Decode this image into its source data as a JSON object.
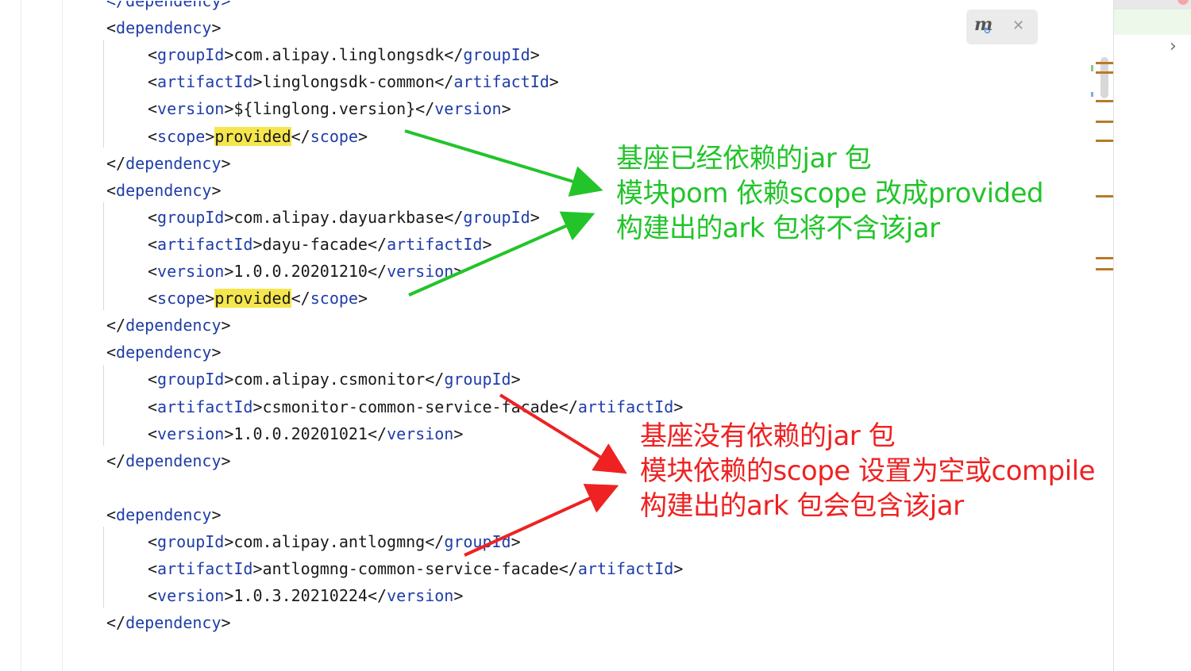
{
  "editor": {
    "lines": [
      {
        "kind": "text",
        "text": "</dependency>"
      },
      {
        "kind": "open",
        "tag": "dependency"
      },
      {
        "kind": "elem",
        "tag": "groupId",
        "value": "com.alipay.linglongsdk"
      },
      {
        "kind": "elem",
        "tag": "artifactId",
        "value": "linglongsdk-common"
      },
      {
        "kind": "elem",
        "tag": "version",
        "value": "${linglong.version}"
      },
      {
        "kind": "elem",
        "tag": "scope",
        "value": "provided",
        "highlight": true
      },
      {
        "kind": "close",
        "tag": "dependency"
      },
      {
        "kind": "open",
        "tag": "dependency"
      },
      {
        "kind": "elem",
        "tag": "groupId",
        "value": "com.alipay.dayuarkbase"
      },
      {
        "kind": "elem",
        "tag": "artifactId",
        "value": "dayu-facade"
      },
      {
        "kind": "elem",
        "tag": "version",
        "value": "1.0.0.20201210"
      },
      {
        "kind": "elem",
        "tag": "scope",
        "value": "provided",
        "highlight": true
      },
      {
        "kind": "close",
        "tag": "dependency"
      },
      {
        "kind": "open",
        "tag": "dependency"
      },
      {
        "kind": "elem",
        "tag": "groupId",
        "value": "com.alipay.csmonitor"
      },
      {
        "kind": "elem",
        "tag": "artifactId",
        "value": "csmonitor-common-service-facade"
      },
      {
        "kind": "elem",
        "tag": "version",
        "value": "1.0.0.20201021"
      },
      {
        "kind": "close",
        "tag": "dependency"
      },
      {
        "kind": "blank"
      },
      {
        "kind": "open",
        "tag": "dependency"
      },
      {
        "kind": "elem",
        "tag": "groupId",
        "value": "com.alipay.antlogmng"
      },
      {
        "kind": "elem",
        "tag": "artifactId",
        "value": "antlogmng-common-service-facade"
      },
      {
        "kind": "elem",
        "tag": "version",
        "value": "1.0.3.20210224"
      },
      {
        "kind": "close",
        "tag": "dependency"
      }
    ]
  },
  "annotations": {
    "green": [
      "基座已经依赖的jar 包",
      "模块pom 依赖scope 改成provided",
      "构建出的ark 包将不含该jar"
    ],
    "red": [
      "基座没有依赖的jar 包",
      "模块依赖的scope 设置为空或compile",
      "构建出的ark 包会包含该jar"
    ],
    "green_color": "#22c42a",
    "red_color": "#ee2222"
  },
  "maven_popup": {
    "icon": "maven-reload-icon",
    "close_icon": "close-icon"
  },
  "colors": {
    "tag": "#1f3da8",
    "highlight": "#f6e64d",
    "text": "#1a1a1a"
  }
}
